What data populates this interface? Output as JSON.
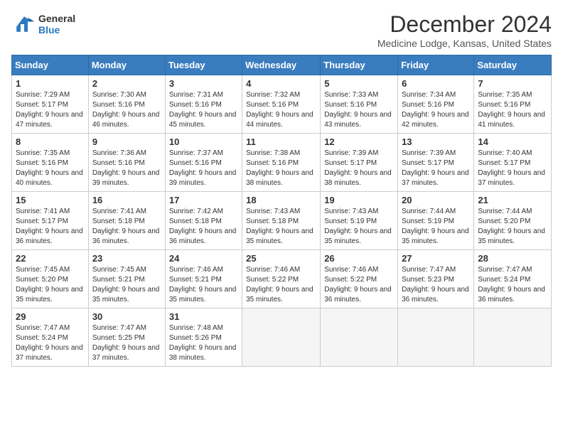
{
  "logo": {
    "line1": "General",
    "line2": "Blue"
  },
  "title": "December 2024",
  "subtitle": "Medicine Lodge, Kansas, United States",
  "headers": [
    "Sunday",
    "Monday",
    "Tuesday",
    "Wednesday",
    "Thursday",
    "Friday",
    "Saturday"
  ],
  "weeks": [
    [
      {
        "day": "1",
        "sunrise": "7:29 AM",
        "sunset": "5:17 PM",
        "daylight": "9 hours and 47 minutes."
      },
      {
        "day": "2",
        "sunrise": "7:30 AM",
        "sunset": "5:16 PM",
        "daylight": "9 hours and 46 minutes."
      },
      {
        "day": "3",
        "sunrise": "7:31 AM",
        "sunset": "5:16 PM",
        "daylight": "9 hours and 45 minutes."
      },
      {
        "day": "4",
        "sunrise": "7:32 AM",
        "sunset": "5:16 PM",
        "daylight": "9 hours and 44 minutes."
      },
      {
        "day": "5",
        "sunrise": "7:33 AM",
        "sunset": "5:16 PM",
        "daylight": "9 hours and 43 minutes."
      },
      {
        "day": "6",
        "sunrise": "7:34 AM",
        "sunset": "5:16 PM",
        "daylight": "9 hours and 42 minutes."
      },
      {
        "day": "7",
        "sunrise": "7:35 AM",
        "sunset": "5:16 PM",
        "daylight": "9 hours and 41 minutes."
      }
    ],
    [
      {
        "day": "8",
        "sunrise": "7:35 AM",
        "sunset": "5:16 PM",
        "daylight": "9 hours and 40 minutes."
      },
      {
        "day": "9",
        "sunrise": "7:36 AM",
        "sunset": "5:16 PM",
        "daylight": "9 hours and 39 minutes."
      },
      {
        "day": "10",
        "sunrise": "7:37 AM",
        "sunset": "5:16 PM",
        "daylight": "9 hours and 39 minutes."
      },
      {
        "day": "11",
        "sunrise": "7:38 AM",
        "sunset": "5:16 PM",
        "daylight": "9 hours and 38 minutes."
      },
      {
        "day": "12",
        "sunrise": "7:39 AM",
        "sunset": "5:17 PM",
        "daylight": "9 hours and 38 minutes."
      },
      {
        "day": "13",
        "sunrise": "7:39 AM",
        "sunset": "5:17 PM",
        "daylight": "9 hours and 37 minutes."
      },
      {
        "day": "14",
        "sunrise": "7:40 AM",
        "sunset": "5:17 PM",
        "daylight": "9 hours and 37 minutes."
      }
    ],
    [
      {
        "day": "15",
        "sunrise": "7:41 AM",
        "sunset": "5:17 PM",
        "daylight": "9 hours and 36 minutes."
      },
      {
        "day": "16",
        "sunrise": "7:41 AM",
        "sunset": "5:18 PM",
        "daylight": "9 hours and 36 minutes."
      },
      {
        "day": "17",
        "sunrise": "7:42 AM",
        "sunset": "5:18 PM",
        "daylight": "9 hours and 36 minutes."
      },
      {
        "day": "18",
        "sunrise": "7:43 AM",
        "sunset": "5:18 PM",
        "daylight": "9 hours and 35 minutes."
      },
      {
        "day": "19",
        "sunrise": "7:43 AM",
        "sunset": "5:19 PM",
        "daylight": "9 hours and 35 minutes."
      },
      {
        "day": "20",
        "sunrise": "7:44 AM",
        "sunset": "5:19 PM",
        "daylight": "9 hours and 35 minutes."
      },
      {
        "day": "21",
        "sunrise": "7:44 AM",
        "sunset": "5:20 PM",
        "daylight": "9 hours and 35 minutes."
      }
    ],
    [
      {
        "day": "22",
        "sunrise": "7:45 AM",
        "sunset": "5:20 PM",
        "daylight": "9 hours and 35 minutes."
      },
      {
        "day": "23",
        "sunrise": "7:45 AM",
        "sunset": "5:21 PM",
        "daylight": "9 hours and 35 minutes."
      },
      {
        "day": "24",
        "sunrise": "7:46 AM",
        "sunset": "5:21 PM",
        "daylight": "9 hours and 35 minutes."
      },
      {
        "day": "25",
        "sunrise": "7:46 AM",
        "sunset": "5:22 PM",
        "daylight": "9 hours and 35 minutes."
      },
      {
        "day": "26",
        "sunrise": "7:46 AM",
        "sunset": "5:22 PM",
        "daylight": "9 hours and 36 minutes."
      },
      {
        "day": "27",
        "sunrise": "7:47 AM",
        "sunset": "5:23 PM",
        "daylight": "9 hours and 36 minutes."
      },
      {
        "day": "28",
        "sunrise": "7:47 AM",
        "sunset": "5:24 PM",
        "daylight": "9 hours and 36 minutes."
      }
    ],
    [
      {
        "day": "29",
        "sunrise": "7:47 AM",
        "sunset": "5:24 PM",
        "daylight": "9 hours and 37 minutes."
      },
      {
        "day": "30",
        "sunrise": "7:47 AM",
        "sunset": "5:25 PM",
        "daylight": "9 hours and 37 minutes."
      },
      {
        "day": "31",
        "sunrise": "7:48 AM",
        "sunset": "5:26 PM",
        "daylight": "9 hours and 38 minutes."
      },
      null,
      null,
      null,
      null
    ]
  ]
}
